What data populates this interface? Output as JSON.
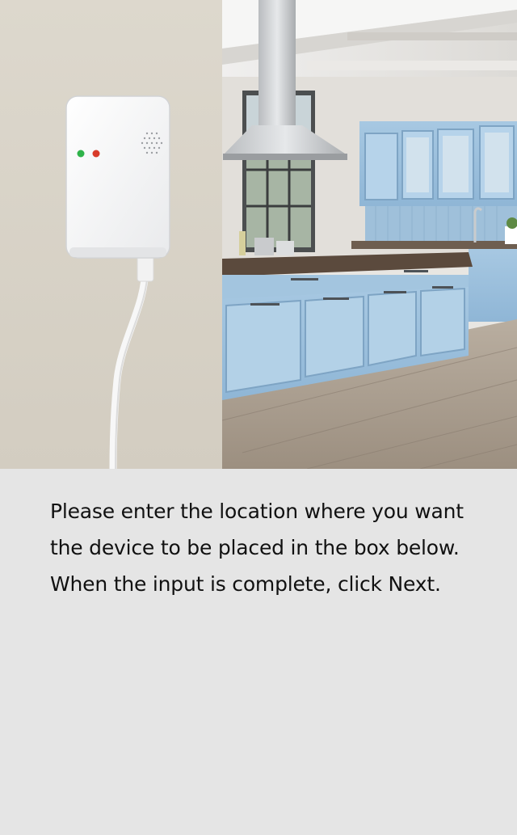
{
  "hero": {
    "left_wall_color": "#d9d4c9",
    "cabinet_color": "#9cc0dc",
    "device_led_green": "#2fb34a",
    "device_led_red": "#d83b2a"
  },
  "instructions": {
    "text": "Please enter the location where you want the device to be placed in the box below. When the input is complete, click Next."
  }
}
